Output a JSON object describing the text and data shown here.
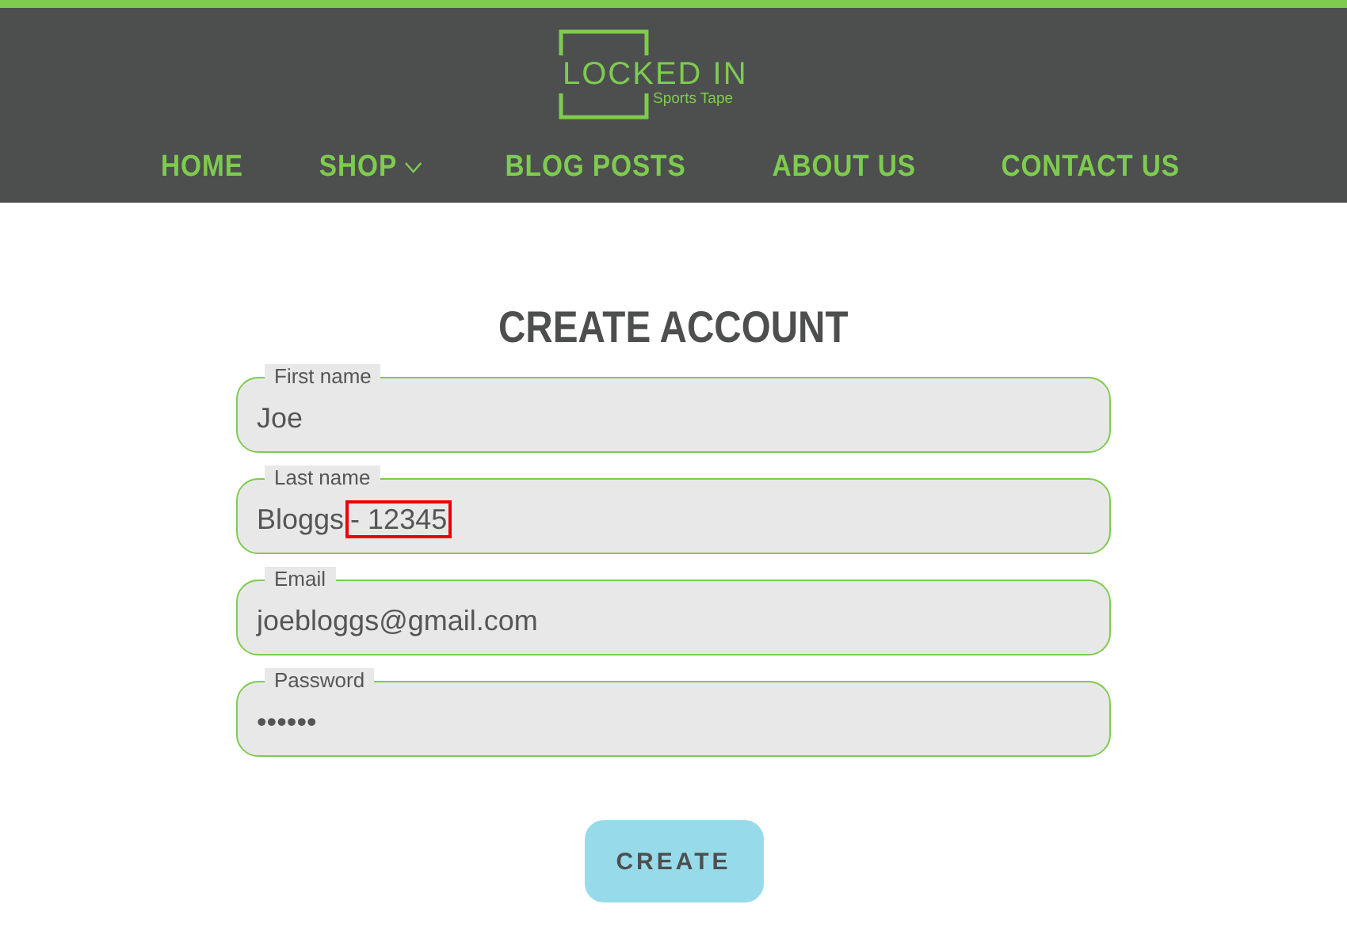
{
  "logo": {
    "title": "LOCKED IN",
    "subtitle": "Sports Tape"
  },
  "nav": [
    {
      "label": "HOME",
      "dropdown": false
    },
    {
      "label": "SHOP",
      "dropdown": true
    },
    {
      "label": "BLOG POSTS",
      "dropdown": false
    },
    {
      "label": "ABOUT US",
      "dropdown": false
    },
    {
      "label": "CONTACT US",
      "dropdown": false
    }
  ],
  "heading": "CREATE ACCOUNT",
  "fields": [
    {
      "label": "First name",
      "value": "Joe"
    },
    {
      "label": "Last name",
      "value": "Bloggs",
      "highlighted": "- 12345"
    },
    {
      "label": "Email",
      "value": "joebloggs@gmail.com"
    },
    {
      "label": "Password",
      "value": "••••••"
    }
  ],
  "submit": "CREATE"
}
